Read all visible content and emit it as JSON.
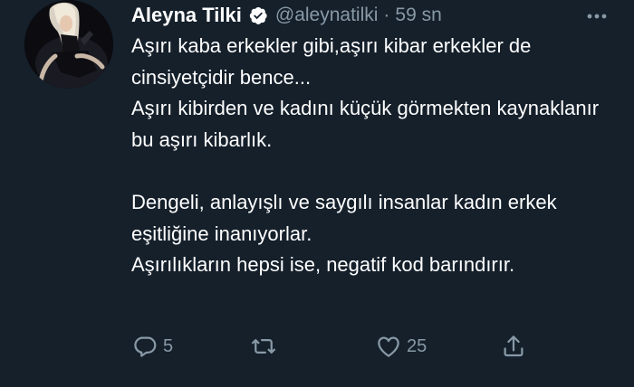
{
  "user": {
    "display_name": "Aleyna Tilki",
    "handle": "@aleynatilki",
    "separator": "·",
    "time": "59 sn",
    "verified_icon": "verified-badge-icon",
    "avatar": "profile-avatar"
  },
  "tweet": {
    "paragraphs": [
      "Aşırı kaba erkekler gibi,aşırı kibar erkekler de cinsiyetçidir bence...\nAşırı kibirden ve kadını küçük görmekten kaynaklanır bu aşırı kibarlık.",
      "Dengeli, anlayışlı ve saygılı insanlar kadın erkek eşitliğine inanıyorlar.\nAşırılıkların hepsi ise, negatif kod barındırır."
    ]
  },
  "actions": {
    "reply": {
      "icon": "reply-icon",
      "count": "5"
    },
    "retweet": {
      "icon": "retweet-icon",
      "count": ""
    },
    "like": {
      "icon": "heart-icon",
      "count": "25"
    },
    "share": {
      "icon": "share-icon",
      "count": ""
    }
  },
  "menu": {
    "icon": "more-options-icon"
  },
  "colors": {
    "background": "#15202b",
    "text_primary": "#ffffff",
    "text_secondary": "#8899a6",
    "verified": "#ffffff"
  }
}
